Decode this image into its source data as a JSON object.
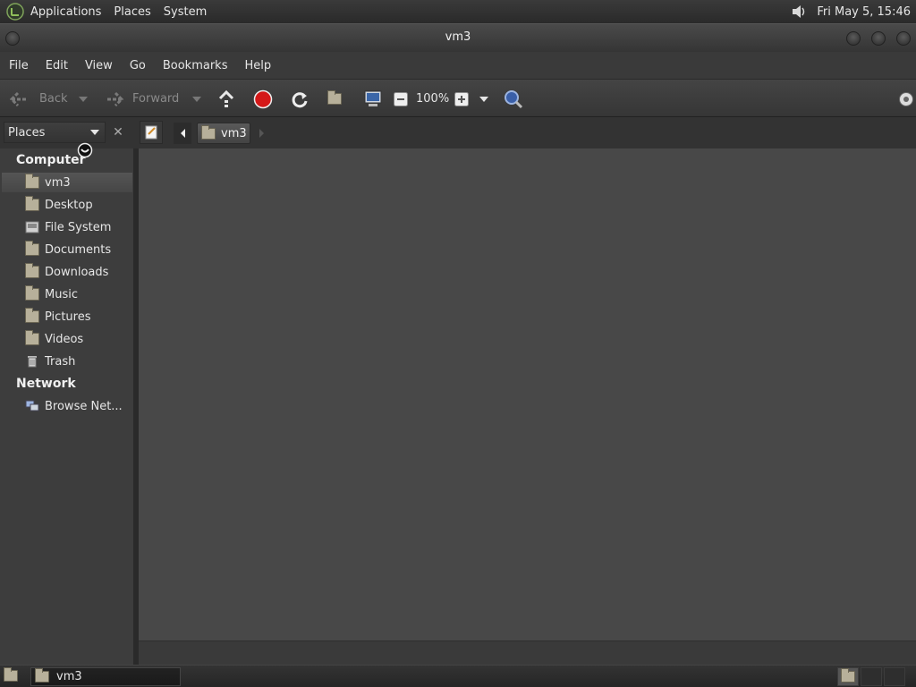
{
  "top_panel": {
    "menus": [
      "Applications",
      "Places",
      "System"
    ],
    "clock": "Fri May  5, 15:46"
  },
  "window": {
    "title": "vm3"
  },
  "menubar": [
    "File",
    "Edit",
    "View",
    "Go",
    "Bookmarks",
    "Help"
  ],
  "toolbar": {
    "back_label": "Back",
    "forward_label": "Forward",
    "zoom": "100%"
  },
  "location": {
    "places_label": "Places",
    "path_current": "vm3"
  },
  "sidebar": {
    "computer_header": "Computer",
    "network_header": "Network",
    "items": [
      {
        "label": "vm3",
        "icon": "home-folder-icon"
      },
      {
        "label": "Desktop",
        "icon": "desktop-folder-icon"
      },
      {
        "label": "File System",
        "icon": "filesystem-icon"
      },
      {
        "label": "Documents",
        "icon": "documents-folder-icon"
      },
      {
        "label": "Downloads",
        "icon": "downloads-folder-icon"
      },
      {
        "label": "Music",
        "icon": "music-folder-icon"
      },
      {
        "label": "Pictures",
        "icon": "pictures-folder-icon"
      },
      {
        "label": "Videos",
        "icon": "videos-folder-icon"
      },
      {
        "label": "Trash",
        "icon": "trash-icon"
      }
    ],
    "network_items": [
      {
        "label": "Browse Net...",
        "icon": "network-icon"
      }
    ]
  },
  "taskbar": {
    "task_label": "vm3"
  },
  "colors": {
    "stop": "#d41818",
    "search": "#3a5fa8"
  }
}
